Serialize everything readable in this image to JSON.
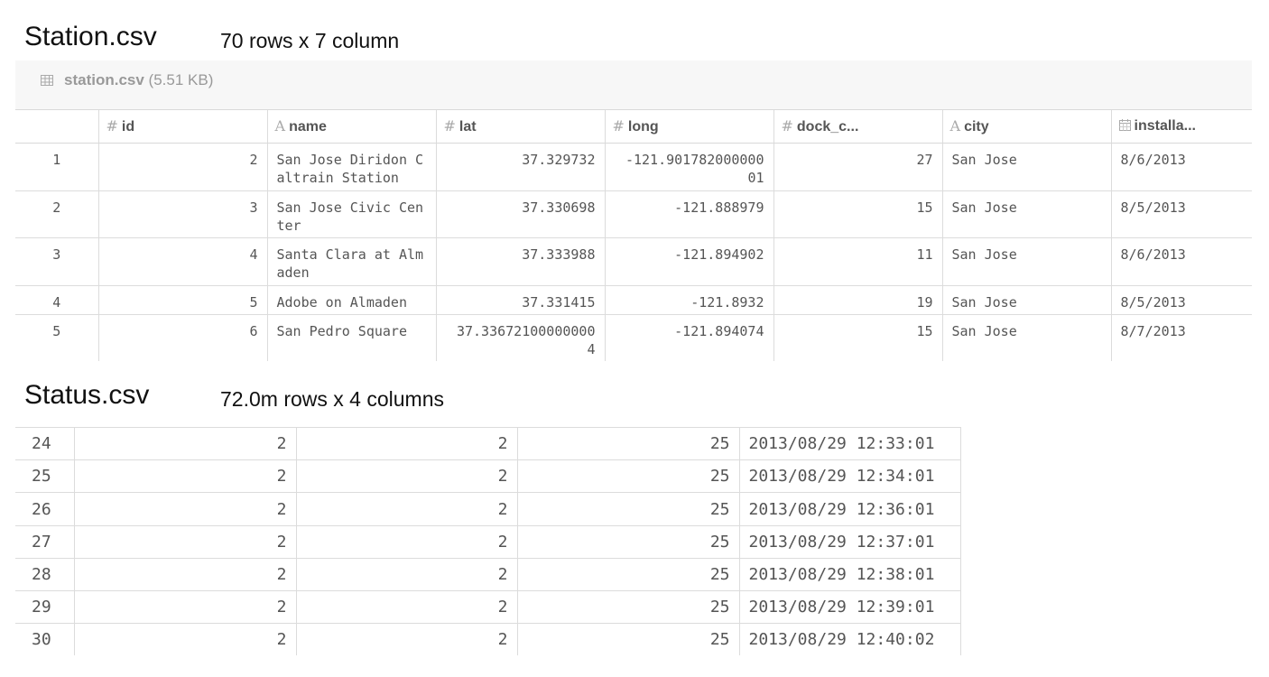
{
  "station_section": {
    "title": "Station.csv",
    "meta": "70 rows x 7 column",
    "file_label": "station.csv",
    "file_size": "(5.51 KB)",
    "columns": [
      {
        "icon": "#",
        "label": "id"
      },
      {
        "icon": "A",
        "label": "name"
      },
      {
        "icon": "#",
        "label": "lat"
      },
      {
        "icon": "#",
        "label": "long"
      },
      {
        "icon": "#",
        "label": "dock_c..."
      },
      {
        "icon": "A",
        "label": "city"
      },
      {
        "icon": "calendar",
        "label": "installa..."
      }
    ],
    "rows": [
      {
        "n": "1",
        "id": "2",
        "name": "San Jose Diridon Caltrain Station",
        "lat": "37.329732",
        "long": "-121.901782000000 01",
        "dock": "27",
        "city": "San Jose",
        "install": "8/6/2013"
      },
      {
        "n": "2",
        "id": "3",
        "name": "San Jose Civic Center",
        "lat": "37.330698",
        "long": "-121.888979",
        "dock": "15",
        "city": "San Jose",
        "install": "8/5/2013"
      },
      {
        "n": "3",
        "id": "4",
        "name": "Santa Clara at Almaden",
        "lat": "37.333988",
        "long": "-121.894902",
        "dock": "11",
        "city": "San Jose",
        "install": "8/6/2013"
      },
      {
        "n": "4",
        "id": "5",
        "name": "Adobe on Almaden",
        "lat": "37.331415",
        "long": "-121.8932",
        "dock": "19",
        "city": "San Jose",
        "install": "8/5/2013"
      },
      {
        "n": "5",
        "id": "6",
        "name": "San Pedro Square",
        "lat": "37.33672100000000 4",
        "long": "-121.894074",
        "dock": "15",
        "city": "San Jose",
        "install": "8/7/2013"
      }
    ]
  },
  "status_section": {
    "title": "Status.csv",
    "meta": "72.0m rows x 4 columns",
    "rows": [
      {
        "n": "24",
        "a": "2",
        "b": "2",
        "c": "25",
        "time": "2013/08/29 12:33:01"
      },
      {
        "n": "25",
        "a": "2",
        "b": "2",
        "c": "25",
        "time": "2013/08/29 12:34:01"
      },
      {
        "n": "26",
        "a": "2",
        "b": "2",
        "c": "25",
        "time": "2013/08/29 12:36:01"
      },
      {
        "n": "27",
        "a": "2",
        "b": "2",
        "c": "25",
        "time": "2013/08/29 12:37:01"
      },
      {
        "n": "28",
        "a": "2",
        "b": "2",
        "c": "25",
        "time": "2013/08/29 12:38:01"
      },
      {
        "n": "29",
        "a": "2",
        "b": "2",
        "c": "25",
        "time": "2013/08/29 12:39:01"
      },
      {
        "n": "30",
        "a": "2",
        "b": "2",
        "c": "25",
        "time": "2013/08/29 12:40:02"
      }
    ]
  }
}
